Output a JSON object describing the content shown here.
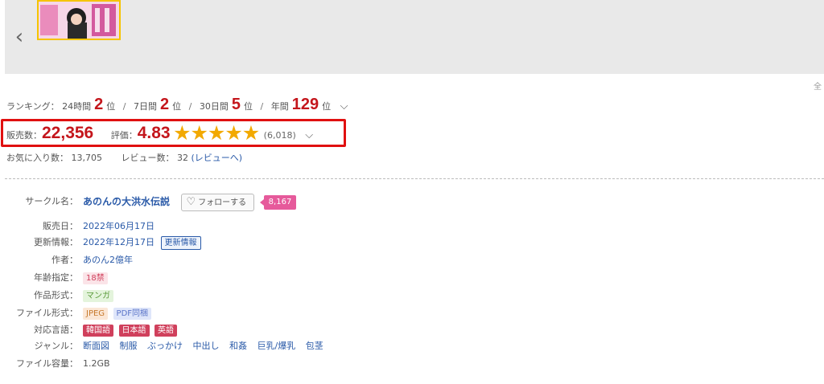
{
  "gallery": {
    "prev_icon": "chevron-left-icon",
    "prev_glyph": "‹",
    "edge_text": "全"
  },
  "ranking": {
    "label": "ランキング：",
    "items": [
      {
        "period": "24時間",
        "rank": "2",
        "unit": "位"
      },
      {
        "period": "7日間",
        "rank": "2",
        "unit": "位"
      },
      {
        "period": "30日間",
        "rank": "5",
        "unit": "位"
      },
      {
        "period": "年間",
        "rank": "129",
        "unit": "位"
      }
    ],
    "separator": "/",
    "expand_icon": "chevron-down-icon",
    "expand_glyph": "⌵"
  },
  "sales": {
    "label": "販売数：",
    "value": "22,356",
    "rating_label": "評価：",
    "rating": "4.83",
    "stars": "★★★★★",
    "rating_count": "(6,018)",
    "expand_glyph": "⌵"
  },
  "favorites": {
    "label": "お気に入り数：",
    "value": "13,705",
    "review_label": "レビュー数：",
    "review_value": "32",
    "review_link": "(レビューへ)"
  },
  "details": {
    "circle": {
      "label": "サークル名：",
      "name": "あのんの大洪水伝説",
      "follow_label": "フォローする",
      "follow_count": "8,167"
    },
    "release": {
      "label": "販売日：",
      "value": "2022年06月17日"
    },
    "updated": {
      "label": "更新情報：",
      "value": "2022年12月17日",
      "tag": "更新情報"
    },
    "author": {
      "label": "作者：",
      "value": "あのん2億年"
    },
    "age": {
      "label": "年齢指定：",
      "tag": "18禁"
    },
    "format": {
      "label": "作品形式：",
      "tag": "マンガ"
    },
    "file_format": {
      "label": "ファイル形式：",
      "tags": [
        "JPEG",
        "PDF同梱"
      ]
    },
    "languages": {
      "label": "対応言語：",
      "tags": [
        "韓国語",
        "日本語",
        "英語"
      ]
    },
    "genre": {
      "label": "ジャンル：",
      "items": [
        "断面図",
        "制服",
        "ぶっかけ",
        "中出し",
        "和姦",
        "巨乳/爆乳",
        "包茎"
      ]
    },
    "filesize": {
      "label": "ファイル容量：",
      "value": "1.2GB"
    }
  },
  "colors": {
    "accent_red": "#c4161c",
    "star": "#f2a900",
    "highlight_border": "#e01010",
    "link": "#2a5aa8"
  }
}
